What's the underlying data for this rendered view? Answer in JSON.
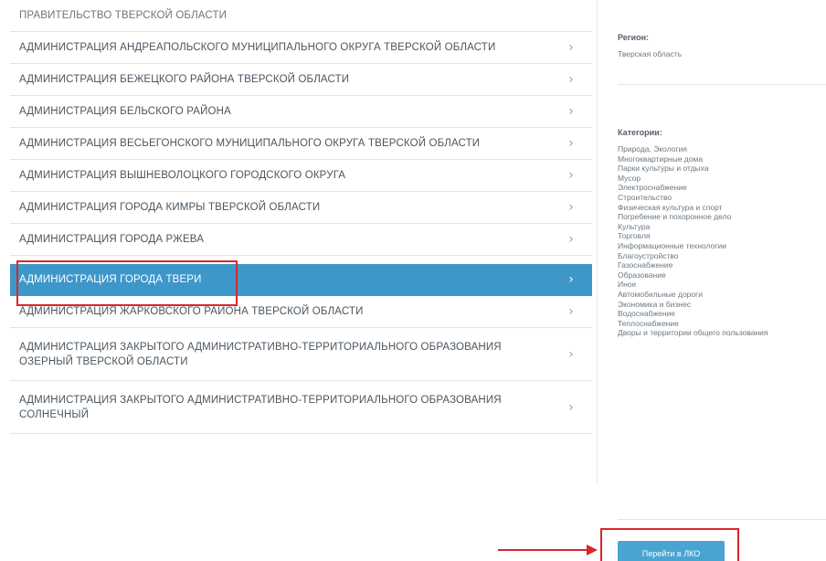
{
  "org_list": {
    "items": [
      {
        "label": "ПРАВИТЕЛЬСТВО ТВЕРСКОЙ ОБЛАСТИ",
        "chevron": "",
        "selected": false
      },
      {
        "label": "АДМИНИСТРАЦИЯ АНДРЕАПОЛЬСКОГО МУНИЦИПАЛЬНОГО ОКРУГА ТВЕРСКОЙ ОБЛАСТИ",
        "chevron": "›",
        "selected": false
      },
      {
        "label": "АДМИНИСТРАЦИЯ БЕЖЕЦКОГО РАЙОНА ТВЕРСКОЙ ОБЛАСТИ",
        "chevron": "›",
        "selected": false
      },
      {
        "label": "АДМИНИСТРАЦИЯ БЕЛЬСКОГО РАЙОНА",
        "chevron": "›",
        "selected": false
      },
      {
        "label": "АДМИНИСТРАЦИЯ ВЕСЬЕГОНСКОГО МУНИЦИПАЛЬНОГО ОКРУГА ТВЕРСКОЙ ОБЛАСТИ",
        "chevron": "›",
        "selected": false
      },
      {
        "label": "АДМИНИСТРАЦИЯ ВЫШНЕВОЛОЦКОГО ГОРОДСКОГО ОКРУГА",
        "chevron": "›",
        "selected": false
      },
      {
        "label": "АДМИНИСТРАЦИЯ ГОРОДА КИМРЫ ТВЕРСКОЙ ОБЛАСТИ",
        "chevron": "›",
        "selected": false
      },
      {
        "label": "АДМИНИСТРАЦИЯ ГОРОДА РЖЕВА",
        "chevron": "›",
        "selected": false
      },
      {
        "label": "АДМИНИСТРАЦИЯ ГОРОДА ТВЕРИ",
        "chevron": "›",
        "selected": true
      },
      {
        "label": "АДМИНИСТРАЦИЯ ЖАРКОВСКОГО РАЙОНА ТВЕРСКОЙ ОБЛАСТИ",
        "chevron": "›",
        "selected": false
      },
      {
        "label": "АДМИНИСТРАЦИЯ ЗАКРЫТОГО АДМИНИСТРАТИВНО-ТЕРРИТОРИАЛЬНОГО ОБРАЗОВАНИЯ ОЗЕРНЫЙ ТВЕРСКОЙ ОБЛАСТИ",
        "chevron": "›",
        "selected": false
      },
      {
        "label": "АДМИНИСТРАЦИЯ ЗАКРЫТОГО АДМИНИСТРАТИВНО-ТЕРРИТОРИАЛЬНОГО ОБРАЗОВАНИЯ СОЛНЕЧНЫЙ",
        "chevron": "›",
        "selected": false
      }
    ]
  },
  "details": {
    "region_title": "Регион:",
    "region_value": "Тверская область",
    "categories_title": "Категории:",
    "categories": [
      "Природа, Экология",
      "Многоквартирные дома",
      "Парки культуры и отдыха",
      "Мусор",
      "Электроснабжение",
      "Строительство",
      "Физическая культура и спорт",
      "Погребение и похоронное дело",
      "Культура",
      "Торговля",
      "Информационные технологии",
      "Благоустройство",
      "Газоснабжение",
      "Образование",
      "Иное",
      "Автомобильные дороги",
      "Экономика и бизнес",
      "Водоснабжение",
      "Теплоснабжение",
      "Дворы и территории общего пользования"
    ],
    "goto_button": "Перейти в ЛКО"
  },
  "colors": {
    "selected_row": "#3e97c9",
    "button": "#49a4d3",
    "annotation": "#d9262c"
  }
}
